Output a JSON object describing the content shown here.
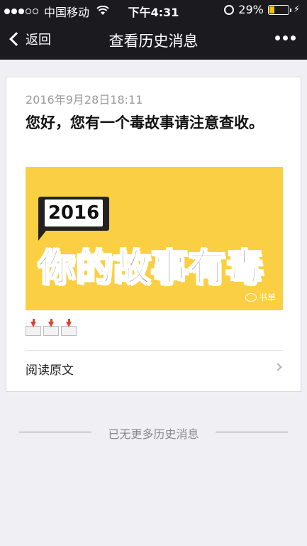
{
  "status_bar": {
    "carrier": "中国移动",
    "time": "下午4:31",
    "battery_percent": "29%",
    "battery_level": 0.29,
    "signal_dots": [
      true,
      true,
      true,
      false,
      false
    ]
  },
  "nav": {
    "back_label": "返回",
    "title": "查看历史消息",
    "more_icon": "more-dots-icon"
  },
  "message": {
    "date": "2016年9月28日18:11",
    "headline": "您好，您有一个毒故事请注意查收。",
    "cover": {
      "badge": "2016",
      "title": "你的故事有毒",
      "watermark": "书单",
      "background_color": "#fbcf43"
    },
    "read_original": "阅读原文"
  },
  "footer": {
    "end_text": "已无更多历史消息"
  }
}
